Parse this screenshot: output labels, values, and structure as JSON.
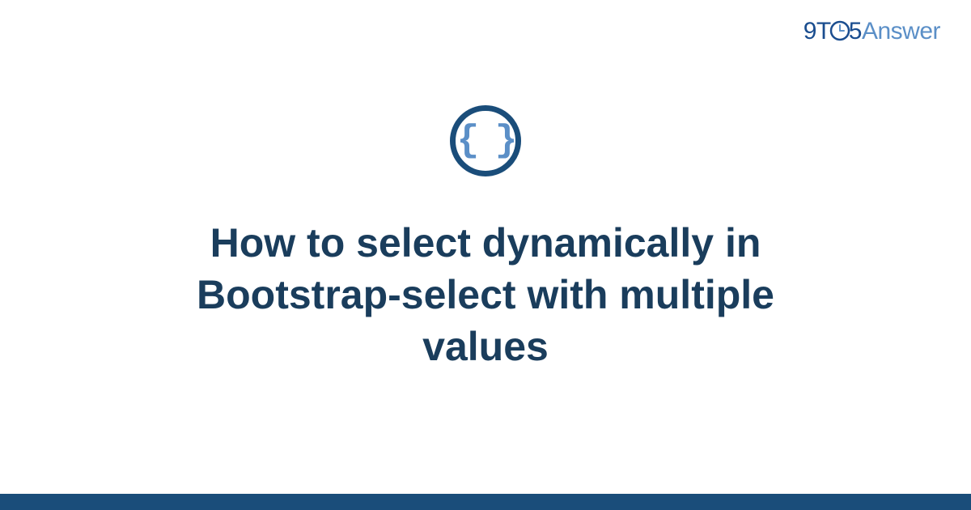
{
  "logo": {
    "part1": "9T",
    "part2": "5",
    "part3": "Answer"
  },
  "icon": {
    "braces": "{ }"
  },
  "title": "How to select dynamically in Bootstrap-select with multiple values",
  "colors": {
    "darkBlue": "#1a4d7a",
    "navyText": "#1a3d5c",
    "lightBlue": "#5b8fc7",
    "logoBlue": "#1a4d8f"
  }
}
